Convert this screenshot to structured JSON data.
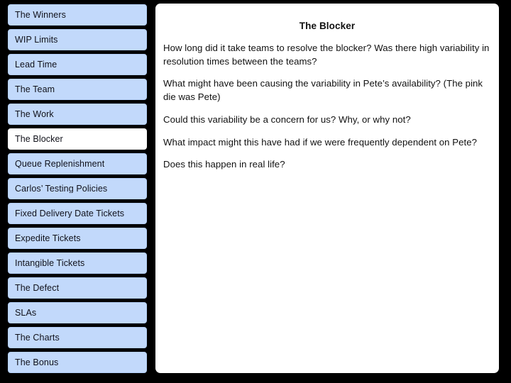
{
  "colors": {
    "background": "#000000",
    "nav_item_bg": "#c2d9fb",
    "nav_item_active_bg": "#ffffff",
    "panel_bg": "#ffffff",
    "text": "#10111a"
  },
  "sidebar": {
    "items": [
      {
        "label": "The Winners",
        "active": false
      },
      {
        "label": "WIP Limits",
        "active": false
      },
      {
        "label": "Lead Time",
        "active": false
      },
      {
        "label": "The Team",
        "active": false
      },
      {
        "label": "The Work",
        "active": false
      },
      {
        "label": "The Blocker",
        "active": true
      },
      {
        "label": "Queue Replenishment",
        "active": false
      },
      {
        "label": "Carlos’ Testing Policies",
        "active": false
      },
      {
        "label": "Fixed Delivery Date Tickets",
        "active": false
      },
      {
        "label": "Expedite Tickets",
        "active": false
      },
      {
        "label": "Intangible Tickets",
        "active": false
      },
      {
        "label": "The Defect",
        "active": false
      },
      {
        "label": "SLAs",
        "active": false
      },
      {
        "label": "The Charts",
        "active": false
      },
      {
        "label": "The Bonus",
        "active": false
      }
    ]
  },
  "main": {
    "title": "The Blocker",
    "paragraphs": [
      "How long did it take teams to resolve the blocker? Was there high variability in resolution times between the teams?",
      "What might have been causing the variability in Pete’s availability? (The pink die was Pete)",
      "Could this variability be a concern for us? Why, or why not?",
      "What impact might this have had if we were frequently dependent on Pete?",
      "Does this happen in real life?"
    ]
  }
}
